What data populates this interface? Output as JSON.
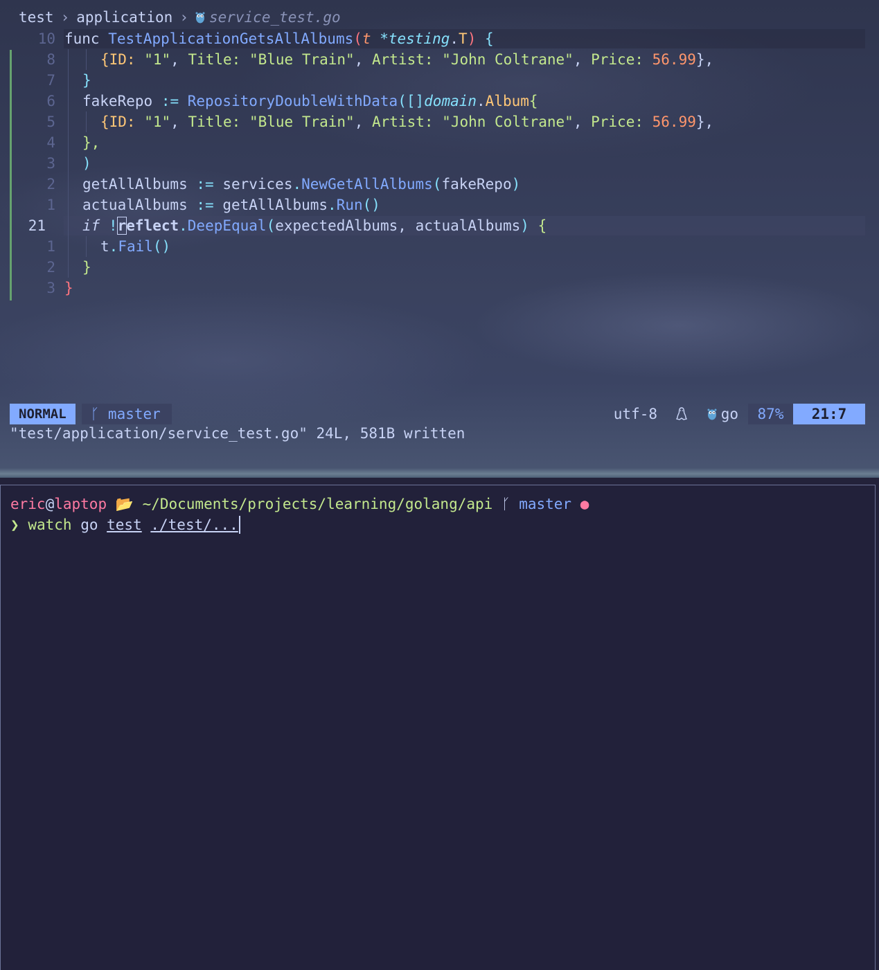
{
  "breadcrumb": {
    "dir1": "test",
    "dir2": "application",
    "file": "service_test.go",
    "file_icon": "gopher-icon"
  },
  "code": {
    "sticky": {
      "num": "10",
      "kw": "func",
      "name": "TestApplicationGetsAllAlbums",
      "lp": "(",
      "param": "t",
      "star": " *",
      "pkg": "testing",
      "dot": ".",
      "type": "T",
      "rp": ")",
      "lb": "{"
    },
    "lines": [
      {
        "num": "8",
        "id_key": "{ID:",
        "id_val": "\"1\"",
        "title_key": "Title:",
        "title_val": "\"Blue Train\"",
        "artist_key": "Artist:",
        "artist_val": "\"John Coltrane\"",
        "price_key": "Price:",
        "price_val": "56.99",
        "end": "},"
      },
      {
        "num": "7",
        "text": "}"
      },
      {
        "num": "6",
        "var": "fakeRepo",
        "op": ":=",
        "call": "RepositoryDoubleWithData",
        "lp": "(",
        "slice": "[]",
        "pkg": "domain",
        "dot": ".",
        "type": "Album",
        "lb": "{"
      },
      {
        "num": "5",
        "id_key": "{ID:",
        "id_val": "\"1\"",
        "title_key": "Title:",
        "title_val": "\"Blue Train\"",
        "artist_key": "Artist:",
        "artist_val": "\"John Coltrane\"",
        "price_key": "Price:",
        "price_val": "56.99",
        "end": "},"
      },
      {
        "num": "4",
        "text": "},"
      },
      {
        "num": "3",
        "text": ")"
      },
      {
        "num": "2",
        "var": "getAllAlbums",
        "op": ":=",
        "pkg": "services",
        "dot": ".",
        "call": "NewGetAllAlbums",
        "lp": "(",
        "arg": "fakeRepo",
        "rp": ")"
      },
      {
        "num": "1",
        "var": "actualAlbums",
        "op": ":=",
        "obj": "getAllAlbums",
        "dot": ".",
        "call": "Run",
        "parens": "()"
      },
      {
        "num": "21",
        "kw": "if",
        "not": "!",
        "cur_char": "r",
        "pkg_rest": "eflect",
        "dot": ".",
        "call": "DeepEqual",
        "lp": "(",
        "a1": "expectedAlbums",
        "comma": ",",
        "a2": "actualAlbums",
        "rp": ")",
        "lb": "{"
      },
      {
        "num": "1",
        "obj": "t",
        "dot": ".",
        "call": "Fail",
        "parens": "()"
      },
      {
        "num": "2",
        "text": "}"
      },
      {
        "num": "3",
        "text": "}"
      }
    ]
  },
  "status": {
    "mode": "NORMAL",
    "branch_icon": "git-branch-icon",
    "branch": "master",
    "encoding": "utf-8",
    "os_icon": "linux-tux-icon",
    "filetype_icon": "gopher-icon",
    "filetype": "go",
    "percent": "87%",
    "position": "21:7"
  },
  "message": "\"test/application/service_test.go\" 24L, 581B written",
  "terminal": {
    "user": "eric",
    "at": "@",
    "host": "laptop",
    "folder_icon": "open-folder-icon",
    "path": "~/Documents/projects/learning/golang/api",
    "branch_icon": "git-branch-icon",
    "branch": "master",
    "dirty": "●",
    "prompt_symbol": "❯",
    "cmd_watch": "watch",
    "cmd_go": "go",
    "cmd_test": "test",
    "cmd_arg": "./test/..."
  },
  "colors": {
    "accent": "#82aaff",
    "string": "#c3e88d",
    "number": "#ff966c",
    "git_added": "#66a26f"
  }
}
